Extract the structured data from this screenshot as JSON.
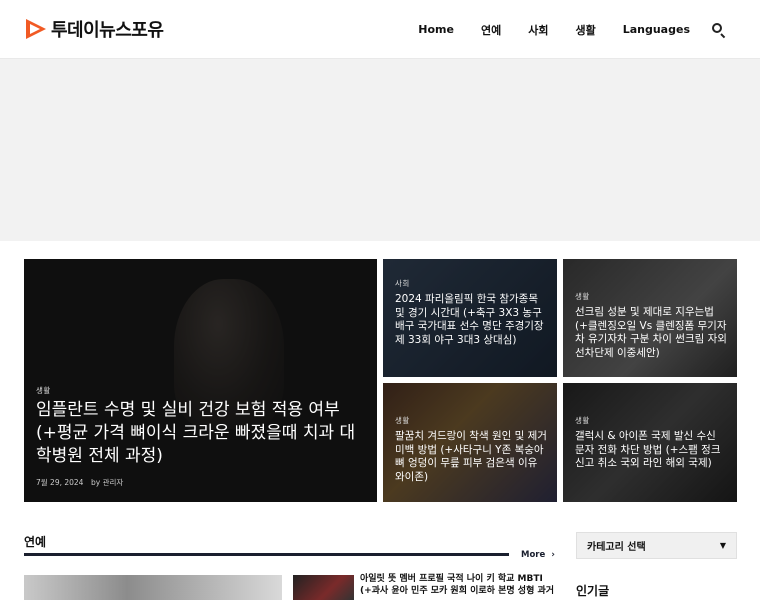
{
  "header": {
    "logo_text": "투데이뉴스포유",
    "nav": [
      "Home",
      "연예",
      "사회",
      "생활",
      "Languages"
    ],
    "brand_colors": {
      "logo_orange": "#f15a24",
      "logo_dark": "#1a1f2e"
    }
  },
  "featured": {
    "big": {
      "category": "생활",
      "title": "임플란트 수명 및 실비 건강 보험 적용 여부 (+평균 가격 뼈이식 크라운 빠졌을때 치과 대학병원 전체 과정)",
      "date": "7월 29, 2024",
      "author": "by 관리자"
    },
    "cards": [
      {
        "category": "사회",
        "title": "2024 파리올림픽 한국 참가종목 및 경기 시간대 (+축구 3X3 농구 배구 국가대표 선수 명단 주경기장 제 33회 야구 3대3 상대심)"
      },
      {
        "category": "생활",
        "title": "선크림 성분 및 제대로 지우는법 (+클렌징오일 Vs 클렌징폼 무기자차 유기자차 구분 차이 썬크림 자외선차단제 이중세안)"
      },
      {
        "category": "생활",
        "title": "팔꿈치 겨드랑이 착색 원인 및 제거 미백 방법 (+사타구니 Y존 복숭아뼈 엉덩이 무릎 피부 검은색 이유 와이존)"
      },
      {
        "category": "생활",
        "title": "갤럭시 & 아이폰 국제 발신 수신 문자 전화 차단 방법 (+스팸 정크신고 취소 국외 라인 해외 국제)"
      }
    ]
  },
  "section": {
    "title": "연예",
    "more": "More",
    "list_title": "아일릿 뜻 멤버 프로필 국적 나이 키 학교 MBTI (+과사 윤아 민주 모카 원희 이로하 본명 성형 과거"
  },
  "sidebar": {
    "category_select": "카테고리 선택",
    "popular_title": "인기글"
  }
}
